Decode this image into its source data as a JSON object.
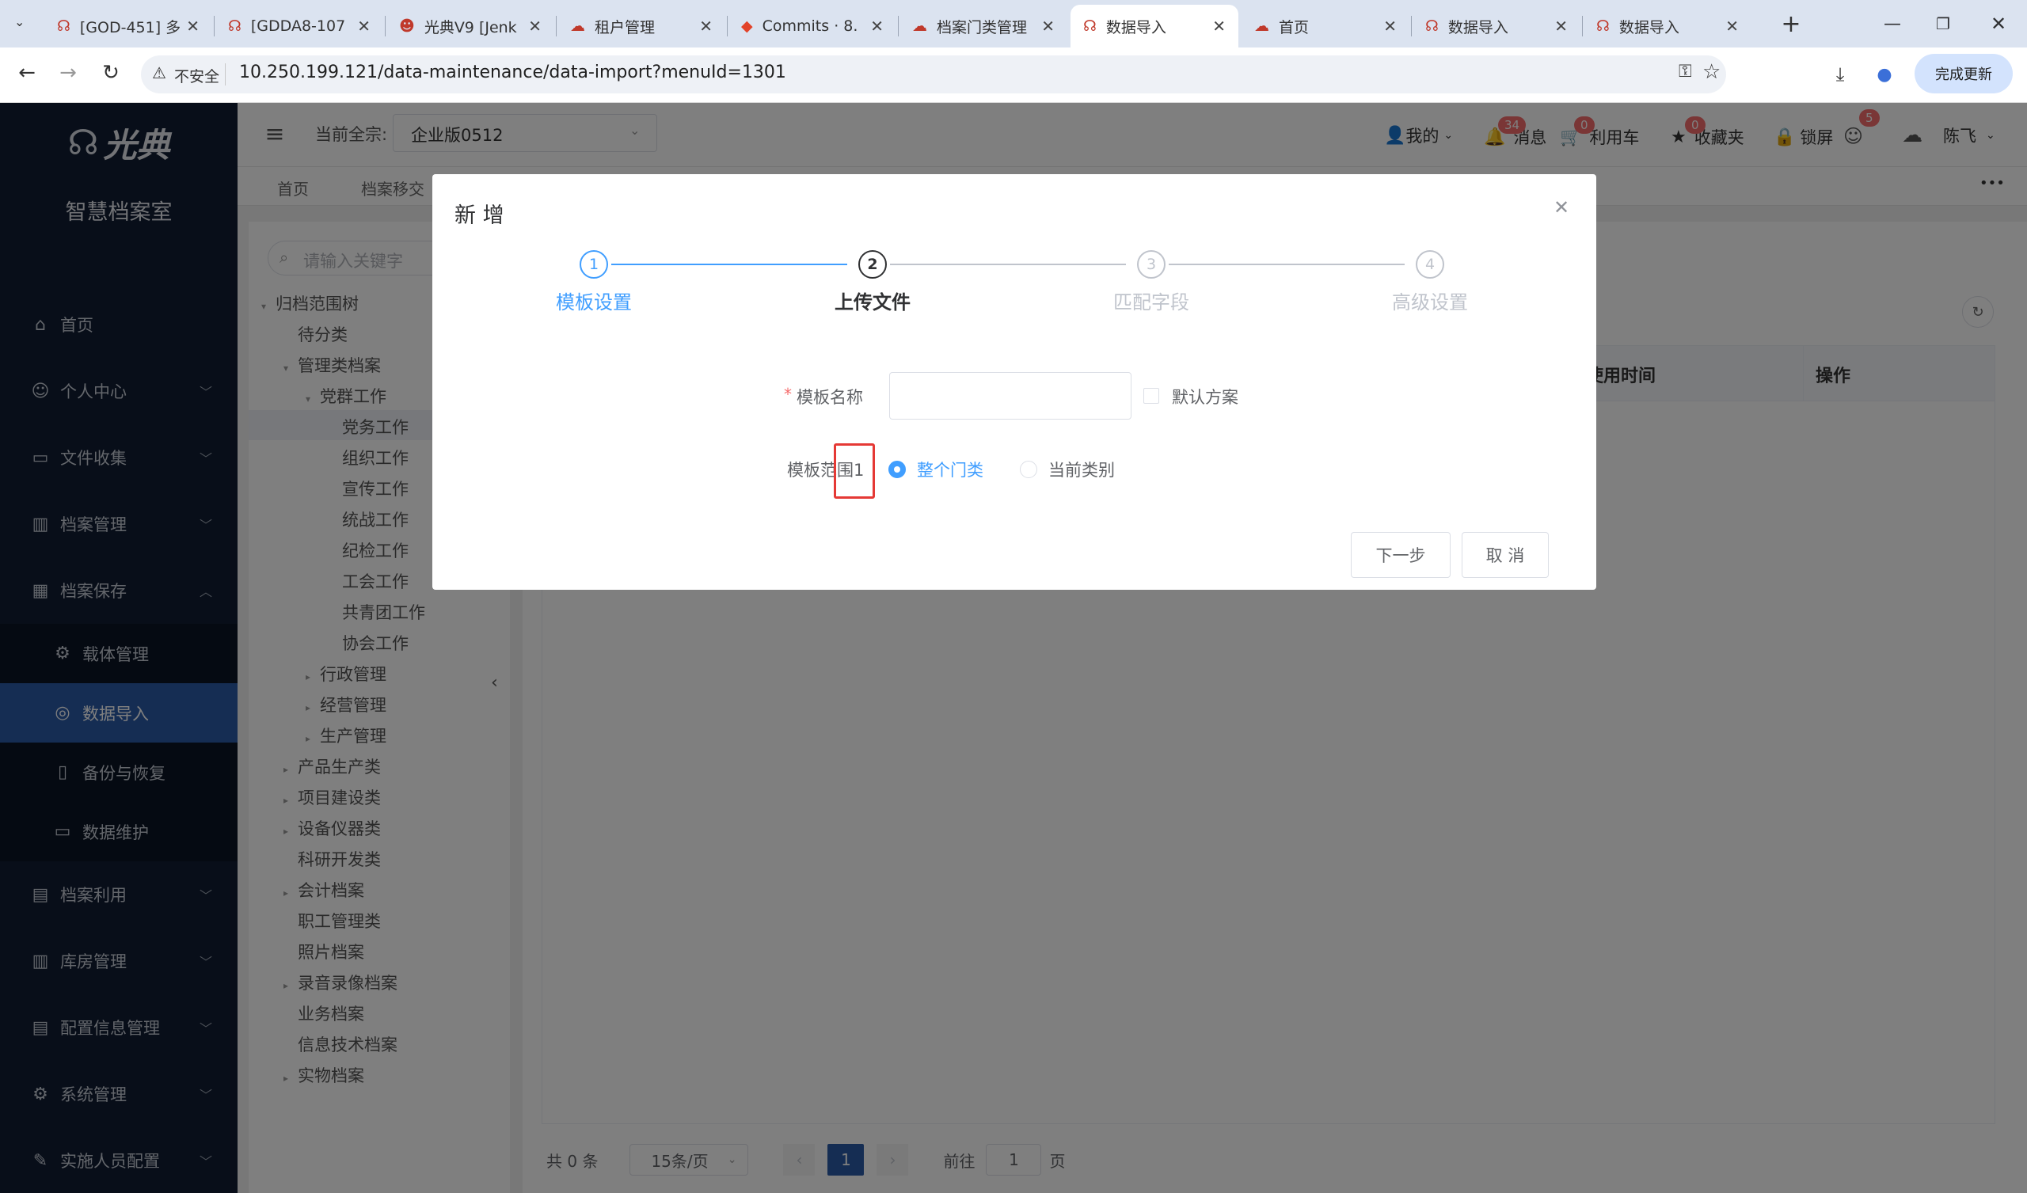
{
  "browser": {
    "tabs": [
      {
        "label": "[GOD-451] 多",
        "active": false
      },
      {
        "label": "[GDDA8-107",
        "active": false
      },
      {
        "label": "光典V9 [Jenk",
        "active": false
      },
      {
        "label": "租户管理",
        "active": false
      },
      {
        "label": "Commits · 8.",
        "active": false
      },
      {
        "label": "档案门类管理",
        "active": false
      },
      {
        "label": "数据导入",
        "active": true
      },
      {
        "label": "首页",
        "active": false
      },
      {
        "label": "数据导入",
        "active": false
      },
      {
        "label": "数据导入",
        "active": false
      }
    ],
    "new_tab": "+",
    "insecure_label": "不安全",
    "url": "10.250.199.121/data-maintenance/data-import?menuId=1301",
    "update_button": "完成更新"
  },
  "sidebar": {
    "logo_text": "光典",
    "subtitle": "智慧档案室",
    "items": [
      {
        "label": "首页",
        "icon": "home-icon",
        "glyph": "⌂"
      },
      {
        "label": "个人中心",
        "icon": "user-icon",
        "glyph": "☺"
      },
      {
        "label": "文件收集",
        "icon": "briefcase-icon",
        "glyph": "▭"
      },
      {
        "label": "档案管理",
        "icon": "bank-icon",
        "glyph": "▥"
      },
      {
        "label": "档案保存",
        "icon": "grid-icon",
        "glyph": "▦"
      }
    ],
    "sub_items": [
      {
        "label": "载体管理",
        "icon": "chip-icon",
        "glyph": "⚙"
      },
      {
        "label": "数据导入",
        "icon": "database-icon",
        "glyph": "◎"
      },
      {
        "label": "备份与恢复",
        "icon": "tablet-icon",
        "glyph": "▯"
      },
      {
        "label": "数据维护",
        "icon": "folder-icon",
        "glyph": "▭"
      }
    ],
    "items_after": [
      {
        "label": "档案利用",
        "icon": "clipboard-icon",
        "glyph": "▤"
      },
      {
        "label": "库房管理",
        "icon": "building-icon",
        "glyph": "▥"
      },
      {
        "label": "配置信息管理",
        "icon": "document-icon",
        "glyph": "▤"
      },
      {
        "label": "系统管理",
        "icon": "gear-icon",
        "glyph": "⚙"
      },
      {
        "label": "实施人员配置",
        "icon": "wrench-icon",
        "glyph": "✎"
      }
    ]
  },
  "header": {
    "fonds_label": "当前全宗:",
    "fonds_value": "企业版0512",
    "my_label": "我的",
    "msg_badge": "34",
    "msg_label": "消息",
    "cart_badge": "0",
    "cart_label": "利用车",
    "fav_badge": "0",
    "fav_label": "收藏夹",
    "lock_label": "锁屏",
    "user_badge": "5",
    "username": "陈飞"
  },
  "tagsbar": {
    "tags": [
      "首页",
      "档案移交"
    ],
    "more": "•••"
  },
  "tree": {
    "search_placeholder": "请输入关键字",
    "nodes": [
      {
        "label": "归档范围树",
        "level": 0,
        "arrow": "▾"
      },
      {
        "label": "待分类",
        "level": 1,
        "arrow": ""
      },
      {
        "label": "管理类档案",
        "level": 1,
        "arrow": "▾"
      },
      {
        "label": "党群工作",
        "level": 2,
        "arrow": "▾"
      },
      {
        "label": "党务工作",
        "level": 3,
        "arrow": "",
        "selected": true
      },
      {
        "label": "组织工作",
        "level": 3,
        "arrow": ""
      },
      {
        "label": "宣传工作",
        "level": 3,
        "arrow": ""
      },
      {
        "label": "统战工作",
        "level": 3,
        "arrow": ""
      },
      {
        "label": "纪检工作",
        "level": 3,
        "arrow": ""
      },
      {
        "label": "工会工作",
        "level": 3,
        "arrow": ""
      },
      {
        "label": "共青团工作",
        "level": 3,
        "arrow": ""
      },
      {
        "label": "协会工作",
        "level": 3,
        "arrow": ""
      },
      {
        "label": "行政管理",
        "level": 2,
        "arrow": "▸"
      },
      {
        "label": "经营管理",
        "level": 2,
        "arrow": "▸"
      },
      {
        "label": "生产管理",
        "level": 2,
        "arrow": "▸"
      },
      {
        "label": "产品生产类",
        "level": 1,
        "arrow": "▸"
      },
      {
        "label": "项目建设类",
        "level": 1,
        "arrow": "▸"
      },
      {
        "label": "设备仪器类",
        "level": 1,
        "arrow": "▸"
      },
      {
        "label": "科研开发类",
        "level": 1,
        "arrow": ""
      },
      {
        "label": "会计档案",
        "level": 1,
        "arrow": "▸"
      },
      {
        "label": "职工管理类",
        "level": 1,
        "arrow": ""
      },
      {
        "label": "照片档案",
        "level": 1,
        "arrow": ""
      },
      {
        "label": "录音录像档案",
        "level": 1,
        "arrow": "▸"
      },
      {
        "label": "业务档案",
        "level": 1,
        "arrow": ""
      },
      {
        "label": "信息技术档案",
        "level": 1,
        "arrow": ""
      },
      {
        "label": "实物档案",
        "level": 1,
        "arrow": "▸"
      }
    ]
  },
  "table": {
    "columns": [
      "使用时间",
      "操作"
    ]
  },
  "pagination": {
    "total": "共 0 条",
    "page_size": "15条/页",
    "current": "1",
    "goto_prefix": "前往",
    "goto_value": "1",
    "goto_suffix": "页"
  },
  "dialog": {
    "title": "新 增",
    "steps": [
      {
        "num": "1",
        "title": "模板设置",
        "state": "done"
      },
      {
        "num": "2",
        "title": "上传文件",
        "state": "active"
      },
      {
        "num": "3",
        "title": "匹配字段",
        "state": "pending"
      },
      {
        "num": "4",
        "title": "高级设置",
        "state": "pending"
      }
    ],
    "form": {
      "name_required": "*",
      "name_label": "模板名称",
      "name_value": "",
      "default_label": "默认方案",
      "scope_label": "模板范围1",
      "scope_options": [
        "整个门类",
        "当前类别"
      ],
      "scope_selected": "整个门类"
    },
    "next_button": "下一步",
    "cancel_button": "取 消"
  },
  "colors": {
    "primary": "#409eff",
    "sidebar_bg": "#101d33",
    "sidebar_active": "#2b5aa6",
    "badge": "#f56c6c",
    "highlight_box": "#e53935"
  }
}
